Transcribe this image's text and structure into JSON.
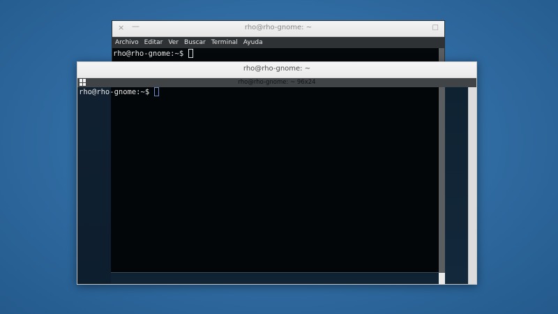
{
  "back_window": {
    "title": "rho@rho-gnome: ~",
    "close_icon": "×",
    "minimize_icon": "—",
    "maximize_icon": "□",
    "menu": [
      "Archivo",
      "Editar",
      "Ver",
      "Buscar",
      "Terminal",
      "Ayuda"
    ],
    "prompt": "rho@rho-gnome:~$ "
  },
  "front_window": {
    "title": "rho@rho-gnome: ~",
    "size_label": "rho@rho-gnome: ~ 96x24",
    "prompt": "rho@rho-gnome:~$ "
  }
}
